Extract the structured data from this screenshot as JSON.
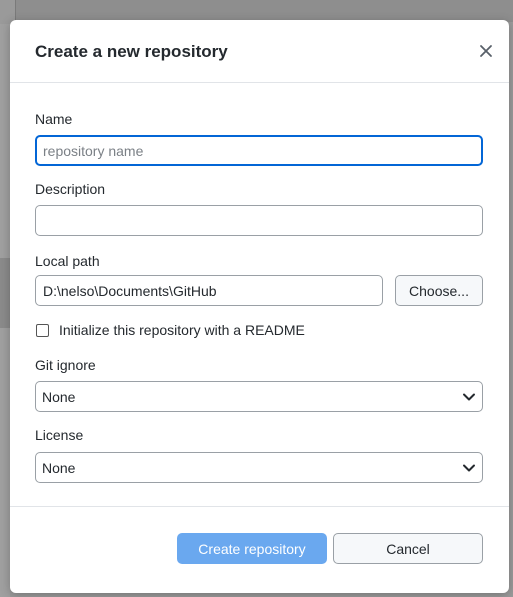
{
  "dialog": {
    "title": "Create a new repository",
    "close_icon": "close-icon"
  },
  "form": {
    "name": {
      "label": "Name",
      "value": "",
      "placeholder": "repository name"
    },
    "description": {
      "label": "Description",
      "value": "",
      "placeholder": ""
    },
    "local_path": {
      "label": "Local path",
      "value": "D:\\nelso\\Documents\\GitHub",
      "choose_label": "Choose..."
    },
    "readme": {
      "label": "Initialize this repository with a README",
      "checked": false
    },
    "git_ignore": {
      "label": "Git ignore",
      "selected": "None",
      "icon": "chevron-down-icon"
    },
    "license": {
      "label": "License",
      "selected": "None",
      "icon": "chevron-down-icon"
    }
  },
  "footer": {
    "create_label": "Create repository",
    "cancel_label": "Cancel"
  },
  "colors": {
    "primary_button": "#6aa8ef",
    "focus_border": "#0366d6",
    "overlay": "#9b9b9b"
  }
}
